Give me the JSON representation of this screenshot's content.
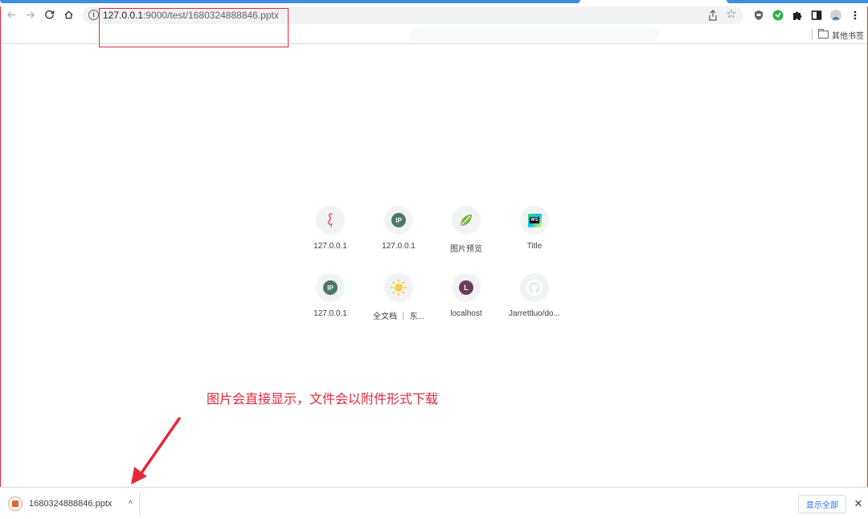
{
  "browser": {
    "url_host": "127.0.0.1",
    "url_rest": ":9000/test/1680324888846.pptx",
    "bookmarks": {
      "other_label": "其他书签"
    }
  },
  "new_tab": {
    "shortcuts": [
      {
        "label": "127.0.0.1",
        "icon": "flamingo-icon"
      },
      {
        "label": "127.0.0.1",
        "icon": "ip-icon",
        "badge": "IP"
      },
      {
        "label": "图片预览",
        "icon": "spring-leaf-icon"
      },
      {
        "label": "Title",
        "icon": "webstorm-icon",
        "badge": "WS"
      },
      {
        "label": "127.0.0.1",
        "icon": "ip-icon",
        "badge": "IP"
      },
      {
        "label": "全文档 ｜ 东...",
        "icon": "sun-icon"
      },
      {
        "label": "localhost",
        "icon": "letter-l-icon",
        "badge": "L"
      },
      {
        "label": "Jarrettluo/do...",
        "icon": "github-icon"
      }
    ]
  },
  "annotation": {
    "text": "图片会直接显示，文件会以附件形式下载"
  },
  "downloads": {
    "file_name": "1680324888846.pptx",
    "show_all_label": "显示全部",
    "close_glyph": "✕",
    "chevron_glyph": "^"
  },
  "colors": {
    "annotation_red": "#e5283a",
    "link_blue": "#1a73e8",
    "tab_blue": "#3f8be8"
  }
}
